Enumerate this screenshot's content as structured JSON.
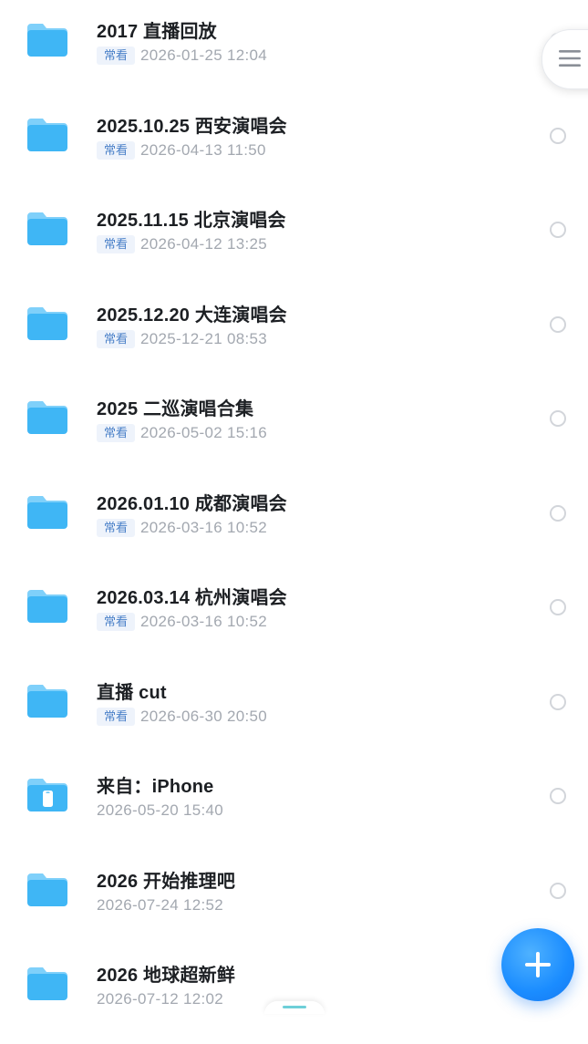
{
  "colors": {
    "folder_front": "#3fb6f5",
    "folder_back": "#7fd0fa",
    "accent": "#1a8cff",
    "tag_bg": "#eef3fb",
    "tag_text": "#4a80c8",
    "date_text": "#a3a8b0"
  },
  "files": [
    {
      "name": "2017 直播回放",
      "tag": "常看",
      "date": "2026-01-25 12:04",
      "icon": "folder-icon"
    },
    {
      "name": "2025.10.25 西安演唱会",
      "tag": "常看",
      "date": "2026-04-13 11:50",
      "icon": "folder-icon"
    },
    {
      "name": "2025.11.15 北京演唱会",
      "tag": "常看",
      "date": "2026-04-12 13:25",
      "icon": "folder-icon"
    },
    {
      "name": "2025.12.20 大连演唱会",
      "tag": "常看",
      "date": "2025-12-21 08:53",
      "icon": "folder-icon"
    },
    {
      "name": "2025 二巡演唱合集",
      "tag": "常看",
      "date": "2026-05-02 15:16",
      "icon": "folder-icon"
    },
    {
      "name": "2026.01.10 成都演唱会",
      "tag": "常看",
      "date": "2026-03-16 10:52",
      "icon": "folder-icon"
    },
    {
      "name": "2026.03.14 杭州演唱会",
      "tag": "常看",
      "date": "2026-03-16 10:52",
      "icon": "folder-icon"
    },
    {
      "name": "直播 cut",
      "tag": "常看",
      "date": "2026-06-30 20:50",
      "icon": "folder-icon"
    },
    {
      "name": "来自：iPhone",
      "tag": "",
      "date": "2026-05-20 15:40",
      "icon": "phone-folder-icon"
    },
    {
      "name": "2026 开始推理吧",
      "tag": "",
      "date": "2026-07-24 12:52",
      "icon": "folder-icon"
    },
    {
      "name": "2026 地球超新鲜",
      "tag": "",
      "date": "2026-07-12 12:02",
      "icon": "folder-icon"
    }
  ],
  "controls": {
    "menu_icon": "hamburger-menu-icon",
    "fab_icon": "plus-icon"
  }
}
